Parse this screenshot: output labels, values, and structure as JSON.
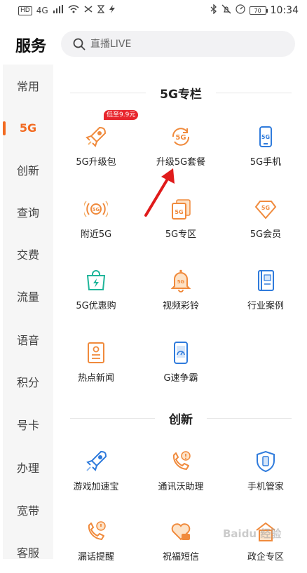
{
  "status_bar": {
    "left_chips": [
      "HD",
      "4G"
    ],
    "battery": "70",
    "time": "10:34"
  },
  "header": {
    "title": "服务",
    "search_placeholder": "直播LIVE"
  },
  "sidebar": {
    "items": [
      "常用",
      "5G",
      "创新",
      "查询",
      "交费",
      "流量",
      "语音",
      "积分",
      "号卡",
      "办理",
      "宽带",
      "客服"
    ],
    "active": "5G"
  },
  "sections": [
    {
      "title": "5G专栏",
      "items": [
        {
          "label": "5G升级包",
          "icon": "rocket-icon",
          "badge": "低至9.9元"
        },
        {
          "label": "升级5G套餐",
          "icon": "5g-refresh-icon"
        },
        {
          "label": "5G手机",
          "icon": "phone-icon"
        },
        {
          "label": "附近5G",
          "icon": "signal-5g-icon"
        },
        {
          "label": "5G专区",
          "icon": "cards-icon"
        },
        {
          "label": "5G会员",
          "icon": "diamond-icon"
        },
        {
          "label": "5G优惠购",
          "icon": "shopping-bag-icon"
        },
        {
          "label": "视频彩铃",
          "icon": "bell-icon"
        },
        {
          "label": "行业案例",
          "icon": "book-icon"
        },
        {
          "label": "热点新闻",
          "icon": "news-icon"
        },
        {
          "label": "G速争霸",
          "icon": "speed-phone-icon"
        }
      ]
    },
    {
      "title": "创新",
      "items": [
        {
          "label": "游戏加速宝",
          "icon": "rocket-icon"
        },
        {
          "label": "通讯沃助理",
          "icon": "call-assistant-icon"
        },
        {
          "label": "手机管家",
          "icon": "shield-icon"
        },
        {
          "label": "漏话提醒",
          "icon": "missed-call-icon"
        },
        {
          "label": "祝福短信",
          "icon": "greeting-sms-icon"
        },
        {
          "label": "政企专区",
          "icon": "enterprise-icon"
        }
      ]
    }
  ],
  "colors": {
    "accent": "#f26a21",
    "badge": "#e8262d",
    "icon_orange": "#f08a3c",
    "icon_blue": "#2f7bdc",
    "icon_teal": "#1fb59a"
  },
  "watermark": "Baidu 经验"
}
